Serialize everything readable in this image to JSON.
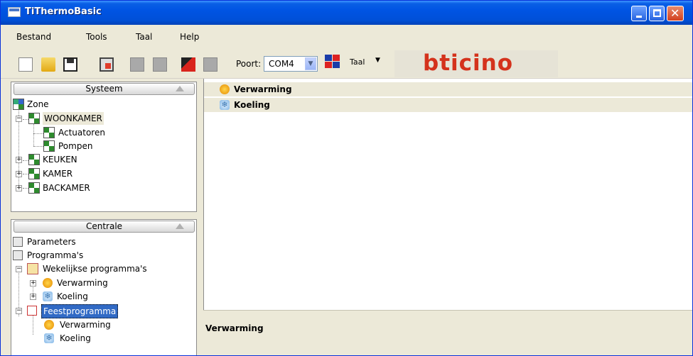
{
  "window": {
    "title": "TiThermoBasic"
  },
  "menu": [
    "Bestand",
    "Tools",
    "Taal",
    "Help"
  ],
  "toolbar": {
    "port_label": "Poort:",
    "port_value": "COM4",
    "language_label": "Taal",
    "logo": "bticino"
  },
  "systeem_panel": {
    "header": "Systeem",
    "root": "Zone",
    "zones": [
      {
        "label": "WOONKAMER",
        "expanded": true,
        "children": [
          "Actuatoren",
          "Pompen"
        ]
      },
      {
        "label": "KEUKEN",
        "expanded": false
      },
      {
        "label": "KAMER",
        "expanded": false
      },
      {
        "label": "BACKAMER",
        "expanded": false
      }
    ]
  },
  "centrale_panel": {
    "header": "Centrale",
    "items": {
      "parameters": "Parameters",
      "programmas": "Programma's",
      "weekly": "Wekelijkse programma's",
      "weekly_heating": "Verwarming",
      "weekly_cooling": "Koeling",
      "party": "Feestprogramma",
      "party_heating": "Verwarming",
      "party_cooling": "Koeling"
    }
  },
  "right_panel": {
    "items": [
      "Verwarming",
      "Koeling"
    ],
    "detail_title": "Verwarming"
  }
}
